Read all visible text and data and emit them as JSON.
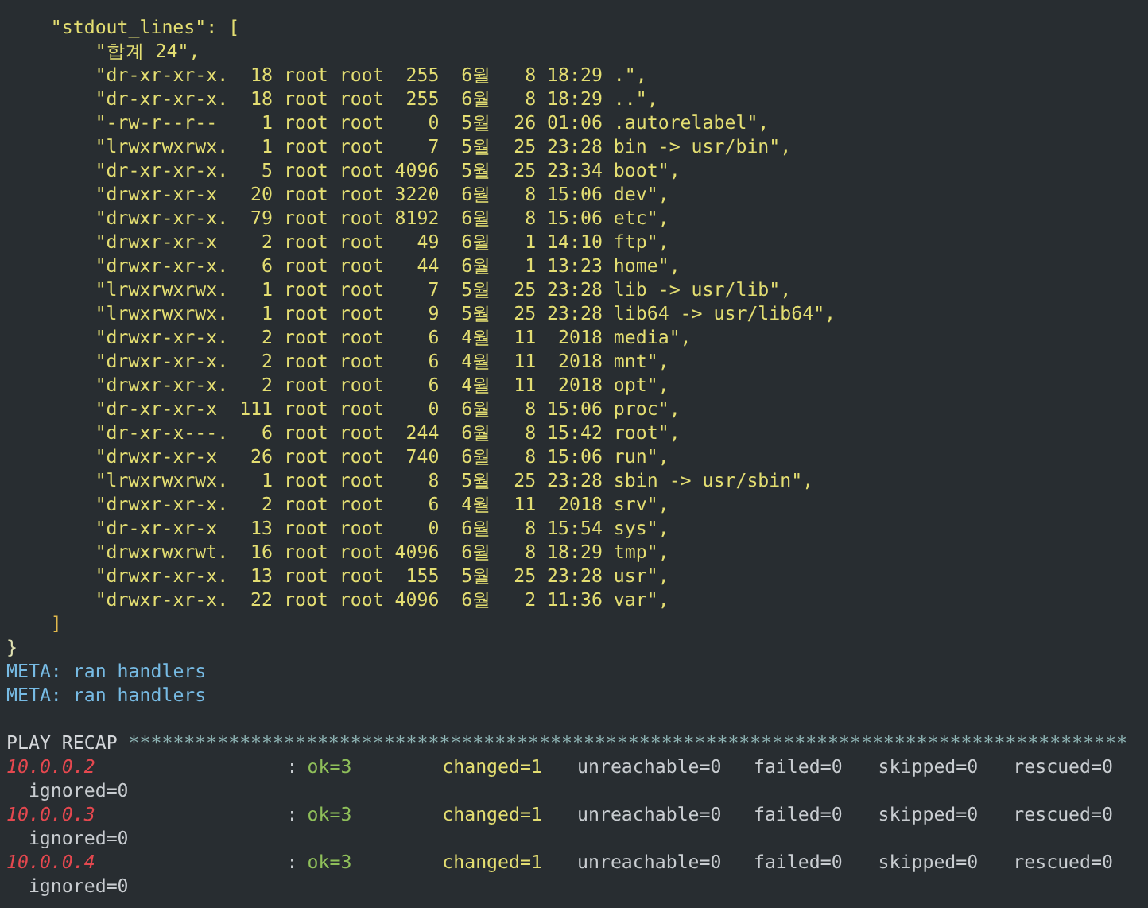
{
  "json_output": {
    "key_line": "\"stdout_lines\": [",
    "lines": [
      "\"합계 24\",",
      "\"dr-xr-xr-x.  18 root root  255  6월   8 18:29 .\",",
      "\"dr-xr-xr-x.  18 root root  255  6월   8 18:29 ..\",",
      "\"-rw-r--r--    1 root root    0  5월  26 01:06 .autorelabel\",",
      "\"lrwxrwxrwx.   1 root root    7  5월  25 23:28 bin -> usr/bin\",",
      "\"dr-xr-xr-x.   5 root root 4096  5월  25 23:34 boot\",",
      "\"drwxr-xr-x   20 root root 3220  6월   8 15:06 dev\",",
      "\"drwxr-xr-x.  79 root root 8192  6월   8 15:06 etc\",",
      "\"drwxr-xr-x    2 root root   49  6월   1 14:10 ftp\",",
      "\"drwxr-xr-x.   6 root root   44  6월   1 13:23 home\",",
      "\"lrwxrwxrwx.   1 root root    7  5월  25 23:28 lib -> usr/lib\",",
      "\"lrwxrwxrwx.   1 root root    9  5월  25 23:28 lib64 -> usr/lib64\",",
      "\"drwxr-xr-x.   2 root root    6  4월  11  2018 media\",",
      "\"drwxr-xr-x.   2 root root    6  4월  11  2018 mnt\",",
      "\"drwxr-xr-x.   2 root root    6  4월  11  2018 opt\",",
      "\"dr-xr-xr-x  111 root root    0  6월   8 15:06 proc\",",
      "\"dr-xr-x---.   6 root root  244  6월   8 15:42 root\",",
      "\"drwxr-xr-x   26 root root  740  6월   8 15:06 run\",",
      "\"lrwxrwxrwx.   1 root root    8  5월  25 23:28 sbin -> usr/sbin\",",
      "\"drwxr-xr-x.   2 root root    6  4월  11  2018 srv\",",
      "\"dr-xr-xr-x   13 root root    0  6월   8 15:54 sys\",",
      "\"drwxrwxrwt.  16 root root 4096  6월   8 18:29 tmp\",",
      "\"drwxr-xr-x.  13 root root  155  5월  25 23:28 usr\",",
      "\"drwxr-xr-x.  22 root root 4096  6월   2 11:36 var\","
    ],
    "close_bracket": "]",
    "close_brace": "}"
  },
  "meta_lines": [
    "META: ran handlers",
    "META: ran handlers"
  ],
  "recap": {
    "title": "PLAY RECAP",
    "stars": "******************************************************************************************",
    "hosts": [
      {
        "host": "10.0.0.2",
        "separator": ":",
        "stats": [
          {
            "text": "ok=3",
            "kind": "ok"
          },
          {
            "text": "changed=1",
            "kind": "changed"
          },
          {
            "text": "unreachable=0",
            "kind": "plain"
          },
          {
            "text": "failed=0",
            "kind": "plain"
          },
          {
            "text": "skipped=0",
            "kind": "plain"
          },
          {
            "text": "rescued=0",
            "kind": "plain"
          }
        ],
        "wrapped": "ignored=0"
      },
      {
        "host": "10.0.0.3",
        "separator": ":",
        "stats": [
          {
            "text": "ok=3",
            "kind": "ok"
          },
          {
            "text": "changed=1",
            "kind": "changed"
          },
          {
            "text": "unreachable=0",
            "kind": "plain"
          },
          {
            "text": "failed=0",
            "kind": "plain"
          },
          {
            "text": "skipped=0",
            "kind": "plain"
          },
          {
            "text": "rescued=0",
            "kind": "plain"
          }
        ],
        "wrapped": "ignored=0"
      },
      {
        "host": "10.0.0.4",
        "separator": ":",
        "stats": [
          {
            "text": "ok=3",
            "kind": "ok"
          },
          {
            "text": "changed=1",
            "kind": "changed"
          },
          {
            "text": "unreachable=0",
            "kind": "plain"
          },
          {
            "text": "failed=0",
            "kind": "plain"
          },
          {
            "text": "skipped=0",
            "kind": "plain"
          },
          {
            "text": "rescued=0",
            "kind": "plain"
          }
        ],
        "wrapped": "ignored=0"
      }
    ]
  }
}
